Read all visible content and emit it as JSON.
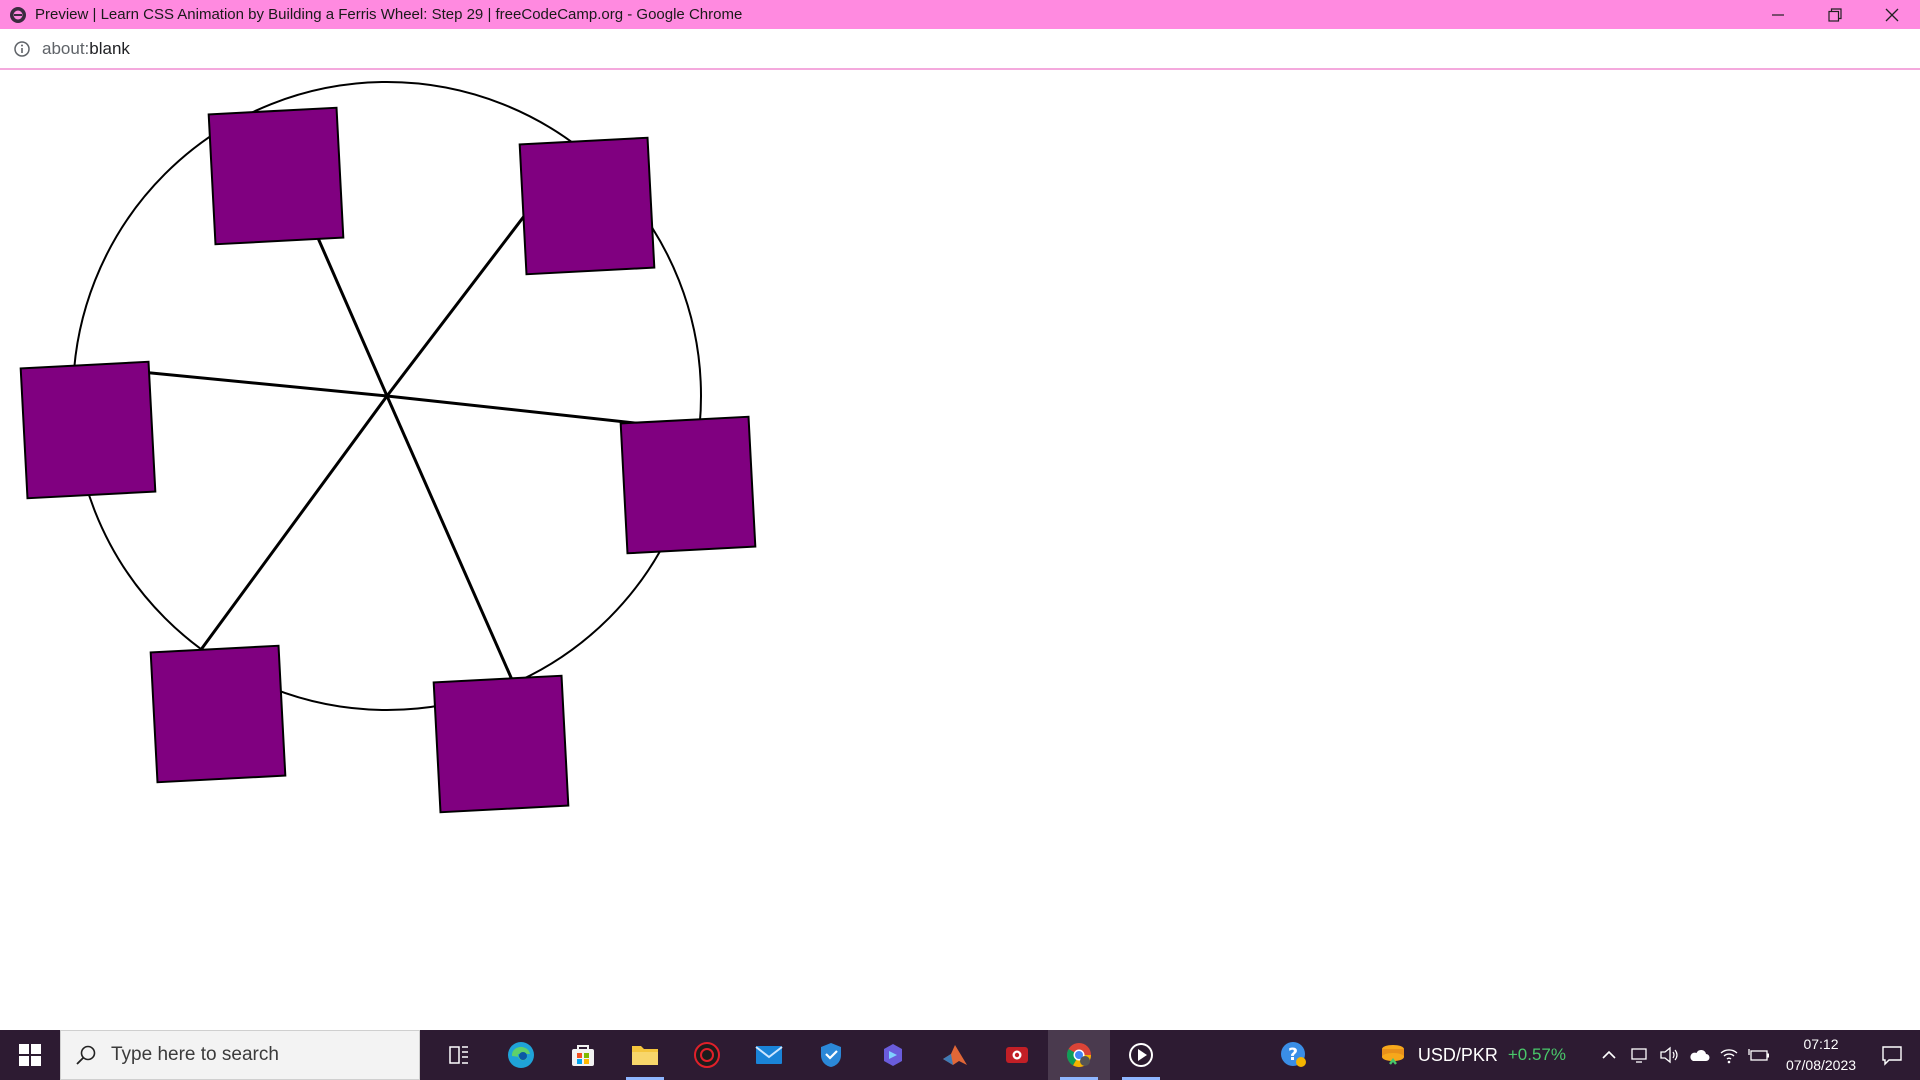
{
  "window": {
    "title": "Preview | Learn CSS Animation by Building a Ferris Wheel: Step 29 | freeCodeCamp.org - Google Chrome",
    "controls": [
      "minimize-icon",
      "restore-icon",
      "close-icon"
    ]
  },
  "address_bar": {
    "scheme": "about:",
    "path": "blank"
  },
  "ferris_wheel": {
    "cabin_count": 6,
    "spoke_count": 6,
    "cabin_color": "#800080",
    "line_color": "#000000"
  },
  "taskbar": {
    "search_placeholder": "Type here to search",
    "apps": [
      "task-view-icon",
      "edge-icon",
      "store-icon",
      "file-explorer-icon",
      "app-red-icon",
      "mail-icon",
      "defender-icon",
      "copilot-icon",
      "matlab-icon",
      "recorder-icon",
      "chrome-icon",
      "media-player-icon"
    ],
    "ticker_pair": "USD/PKR",
    "ticker_change": "+0.57%",
    "time": "07:12",
    "date": "07/08/2023"
  },
  "colors": {
    "titlebar": "#ff8ae0",
    "taskbar": "#2d1b32",
    "accent_positive": "#49c86a"
  }
}
